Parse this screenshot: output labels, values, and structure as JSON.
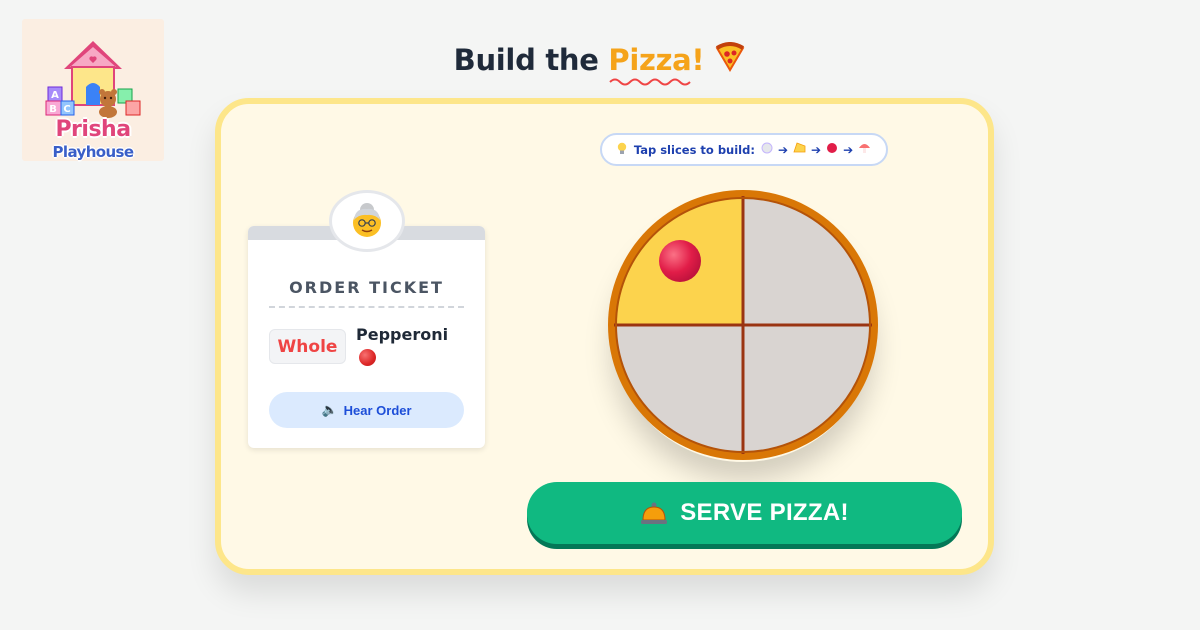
{
  "logo": {
    "line1": "Prisha",
    "line2": "Playhouse",
    "block_letters": [
      "A",
      "B",
      "C"
    ]
  },
  "title": {
    "prefix": "Build the ",
    "accent": "Pizza!",
    "icon": "pizza-slice-icon"
  },
  "hint": {
    "icon": "lightbulb-icon",
    "text": "Tap slices to build:",
    "sequence": [
      "dough-ball-icon",
      "cheese-icon",
      "pepperoni-icon",
      "mushroom-icon"
    ]
  },
  "ticket": {
    "customer_icon": "grandma-icon",
    "title": "ORDER TICKET",
    "portion": "Whole",
    "topping": "Pepperoni",
    "topping_icon": "pepperoni-icon",
    "hear_icon": "speaker-icon",
    "hear_label": "Hear Order"
  },
  "pizza": {
    "slices": [
      {
        "position": "top-left",
        "state": "cheese",
        "topping": "pepperoni"
      },
      {
        "position": "top-right",
        "state": "dough",
        "topping": null
      },
      {
        "position": "bottom-left",
        "state": "dough",
        "topping": null
      },
      {
        "position": "bottom-right",
        "state": "dough",
        "topping": null
      }
    ],
    "colors": {
      "crust": "#d97706",
      "dough": "#d9d4d1",
      "cheese": "#fcd34d",
      "pepperoni": "#e11d48",
      "divider": "#9a3412"
    }
  },
  "serve": {
    "icon": "bell-icon",
    "label": "SERVE PIZZA!"
  },
  "colors": {
    "accent": "#f5a31a",
    "card_bg": "#fff9e6",
    "card_border": "#fde68a",
    "serve_green": "#10b981"
  }
}
